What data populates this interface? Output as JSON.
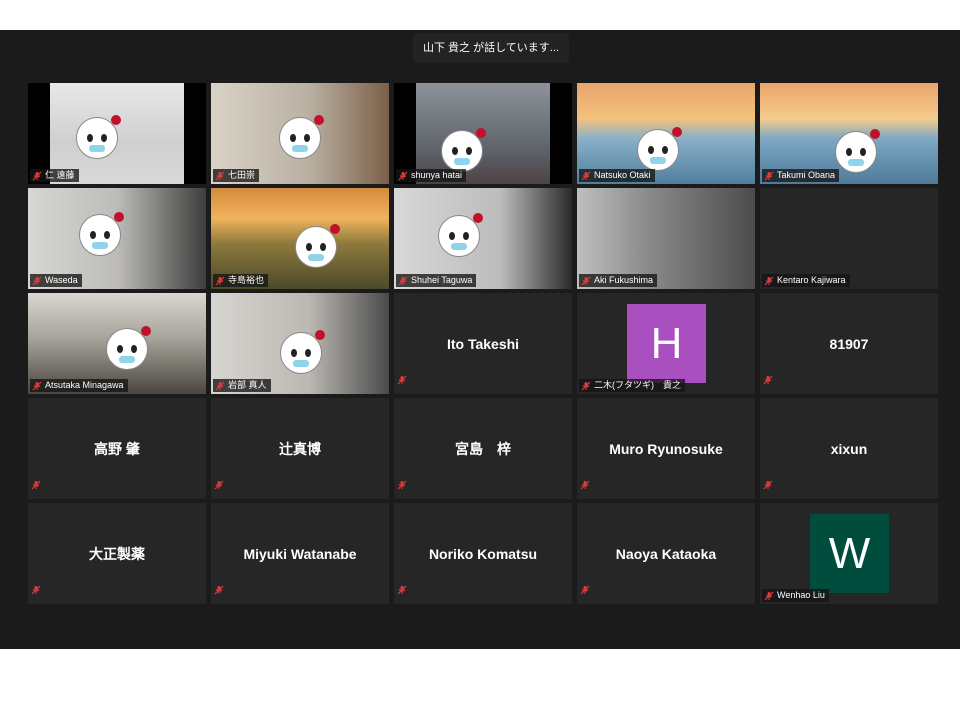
{
  "speaker_banner": "山下 貴之 が話しています...",
  "colors": {
    "stage_bg": "#1b1b1b",
    "tile_bg": "#262626",
    "muted_mic": "#d32f2f",
    "avatar_h": "#a94fc0",
    "avatar_w": "#004d3e"
  },
  "participants": [
    {
      "name": "仁 遠藤",
      "video": true
    },
    {
      "name": "七田崇",
      "video": true
    },
    {
      "name": "shunya hatai",
      "video": true
    },
    {
      "name": "Natsuko Otaki",
      "video": true
    },
    {
      "name": "Takumi Obana",
      "video": true
    },
    {
      "name": "Waseda",
      "video": true
    },
    {
      "name": "寺島裕也",
      "video": true
    },
    {
      "name": "Shuhei Taguwa",
      "video": true
    },
    {
      "name": "Aki Fukushima",
      "video": true
    },
    {
      "name": "Kentaro Kajiwara",
      "video": false
    },
    {
      "name": "Atsutaka Minagawa",
      "video": true
    },
    {
      "name": "岩部 真人",
      "video": true
    },
    {
      "name": "Ito Takeshi",
      "video": false
    },
    {
      "name": "二木(フタツギ)　貴之",
      "video": false,
      "avatar_letter": "H"
    },
    {
      "name": "81907",
      "video": false
    },
    {
      "name": "高野 肇",
      "video": false
    },
    {
      "name": "辻真博",
      "video": false
    },
    {
      "name": "宮島　梓",
      "video": false
    },
    {
      "name": "Muro Ryunosuke",
      "video": false
    },
    {
      "name": "xixun",
      "video": false
    },
    {
      "name": "大正製薬",
      "video": false
    },
    {
      "name": "Miyuki Watanabe",
      "video": false
    },
    {
      "name": "Noriko Komatsu",
      "video": false
    },
    {
      "name": "Naoya Kataoka",
      "video": false
    },
    {
      "name": "Wenhao Liu",
      "video": false,
      "avatar_letter": "W"
    }
  ]
}
